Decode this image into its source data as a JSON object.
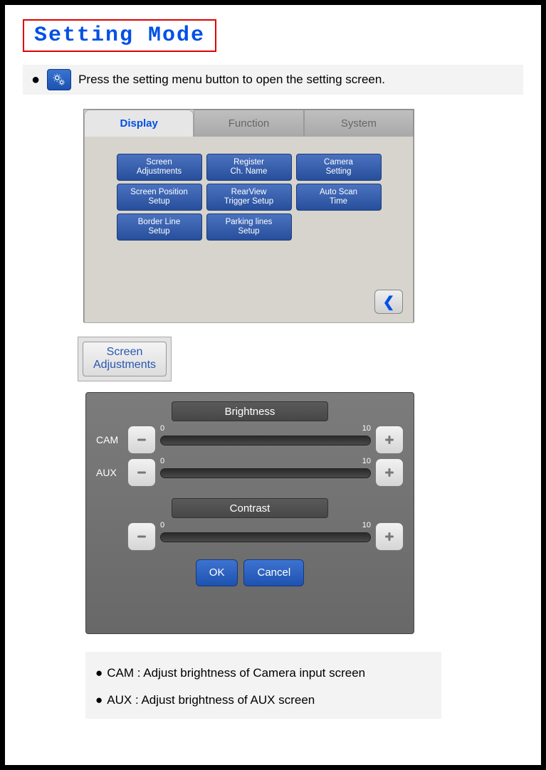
{
  "title": "Setting Mode",
  "instruction": "Press the setting menu button to open the setting screen.",
  "tabs": {
    "display": "Display",
    "function": "Function",
    "system": "System"
  },
  "menu": {
    "b0": "Screen\nAdjustments",
    "b1": "Register\nCh. Name",
    "b2": "Camera\nSetting",
    "b3": "Screen Position\nSetup",
    "b4": "RearView\nTrigger Setup",
    "b5": "Auto Scan\nTime",
    "b6": "Border Line\nSetup",
    "b7": "Parking lines\nSetup"
  },
  "sa_button_l1": "Screen",
  "sa_button_l2": "Adjustments",
  "adjust": {
    "brightness_hdr": "Brightness",
    "contrast_hdr": "Contrast",
    "cam_label": "CAM",
    "aux_label": "AUX",
    "min": "0",
    "max": "10",
    "ok": "OK",
    "cancel": "Cancel"
  },
  "notes": {
    "cam": "CAM : Adjust brightness of Camera input screen",
    "aux": "AUX : Adjust brightness of AUX screen"
  }
}
